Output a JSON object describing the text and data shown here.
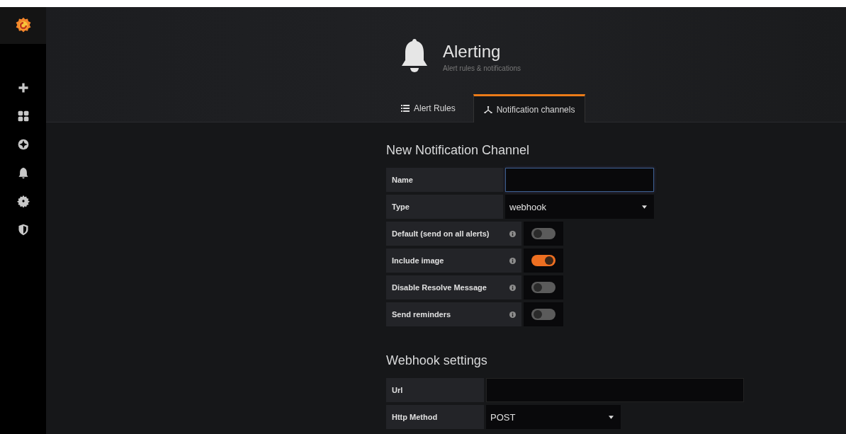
{
  "header": {
    "title": "Alerting",
    "subtitle": "Alert rules & notifications"
  },
  "tabs": [
    {
      "label": "Alert Rules",
      "selected": false
    },
    {
      "label": "Notification channels",
      "selected": true
    }
  ],
  "form": {
    "title": "New Notification Channel",
    "rows": [
      {
        "kind": "input",
        "label": "Name",
        "focused": true
      },
      {
        "kind": "select",
        "label": "Type",
        "value": "webhook"
      },
      {
        "kind": "toggle",
        "label": "Default (send on all alerts)",
        "on": false
      },
      {
        "kind": "toggle",
        "label": "Include image",
        "on": true
      },
      {
        "kind": "toggle",
        "label": "Disable Resolve Message",
        "on": false
      },
      {
        "kind": "toggle",
        "label": "Send reminders",
        "on": false
      }
    ]
  },
  "webhook_settings": {
    "title": "Webhook settings",
    "rows": [
      {
        "kind": "input",
        "label": "Url",
        "focused": false
      },
      {
        "kind": "select",
        "label": "Http Method",
        "value": "POST"
      }
    ]
  }
}
